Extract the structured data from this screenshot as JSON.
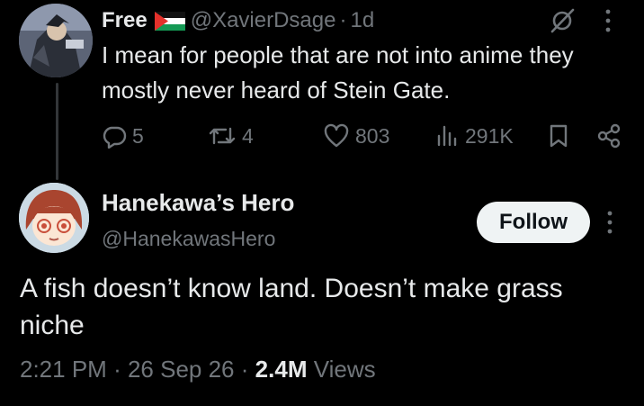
{
  "reply": {
    "display_name": "Free",
    "flag_icon": "palestine-flag-icon",
    "handle": "@XavierDsage",
    "separator": "·",
    "time": "1d",
    "text": "I mean for people that are not into anime they mostly never heard of Stein Gate.",
    "actions": {
      "replies": "5",
      "reposts": "4",
      "likes": "803",
      "views": "291K"
    },
    "icons": [
      "reply-icon",
      "repost-icon",
      "like-icon",
      "views-icon",
      "bookmark-icon",
      "share-icon",
      "grok-icon",
      "more-icon"
    ]
  },
  "main_post": {
    "display_name": "Hanekawa’s Hero",
    "handle": "@HanekawasHero",
    "follow_label": "Follow",
    "text": "A fish doesn’t know land. Doesn’t make grass niche",
    "time": "2:21 PM",
    "date": "26 Sep 26",
    "dot": "·",
    "views_count": "2.4M",
    "views_label": "Views"
  },
  "colors": {
    "background": "#000000",
    "text": "#e7e9ea",
    "muted": "#71767b",
    "follow_bg": "#eff3f4",
    "thread_line": "#333639"
  }
}
